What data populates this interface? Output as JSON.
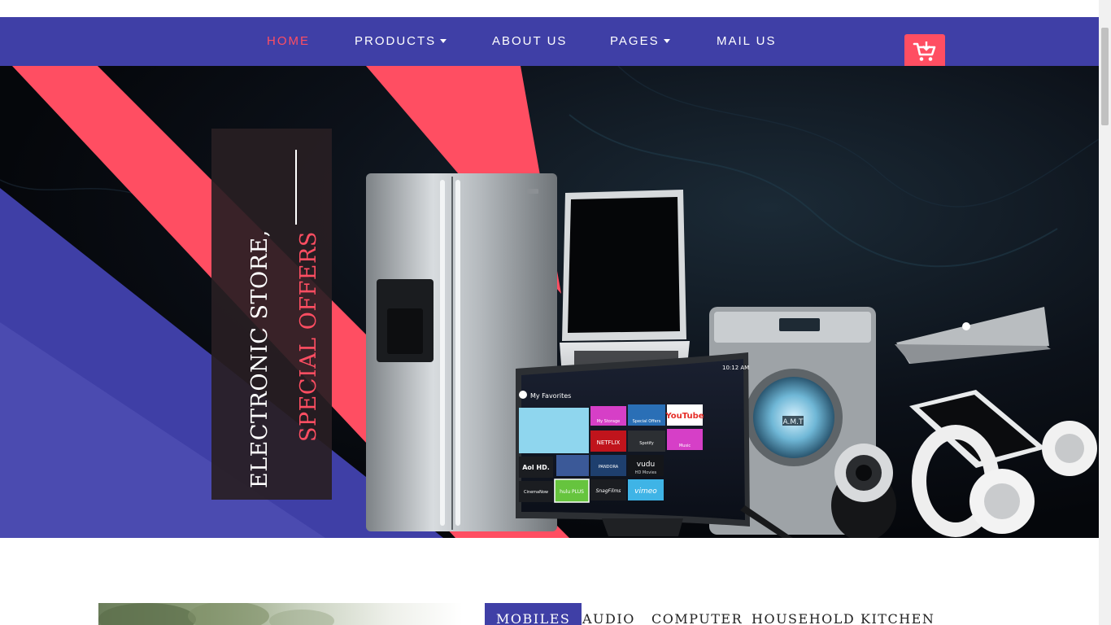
{
  "nav": {
    "items": [
      {
        "label": "HOME",
        "active": true,
        "dropdown": false
      },
      {
        "label": "PRODUCTS",
        "active": false,
        "dropdown": true
      },
      {
        "label": "ABOUT US",
        "active": false,
        "dropdown": false
      },
      {
        "label": "PAGES",
        "active": false,
        "dropdown": true
      },
      {
        "label": "MAIL US",
        "active": false,
        "dropdown": false
      }
    ],
    "cart_icon": "cart-icon"
  },
  "hero": {
    "caption_line1": "ELECTRONIC STORE,",
    "caption_line2": "SPECIAL OFFERS",
    "screen_time": "10:12 AM",
    "screen_title": "My Favorites",
    "apps": [
      "My Storage",
      "Special Offers",
      "YouTube",
      "NETFLIX",
      "Spotify",
      "Music",
      "Aol HD.",
      "PANDORA",
      "vudu",
      "HD Movies",
      "CinemaNow",
      "hulu PLUS",
      "SnagFilms",
      "vimeo"
    ],
    "brand_label": "A.M.T"
  },
  "tabs": [
    {
      "label": "MOBILES",
      "active": true
    },
    {
      "label": "AUDIO",
      "active": false
    },
    {
      "label": "COMPUTER",
      "active": false
    },
    {
      "label": "HOUSEHOLD",
      "active": false
    },
    {
      "label": "KITCHEN",
      "active": false
    }
  ],
  "colors": {
    "nav_bg": "#3f3fa6",
    "accent": "#ff4e62",
    "hero_dark": "#0a0c14"
  }
}
